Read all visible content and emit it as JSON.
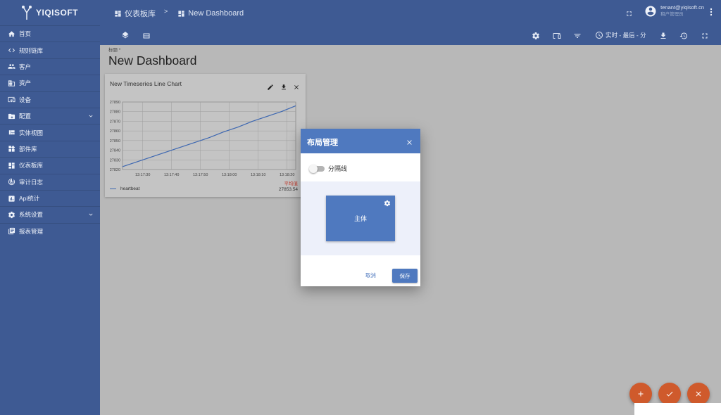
{
  "app": {
    "logo_text": "YIQISOFT"
  },
  "sidebar": {
    "items": [
      {
        "label": "首页",
        "icon": "home-icon"
      },
      {
        "label": "规则链库",
        "icon": "code-icon"
      },
      {
        "label": "客户",
        "icon": "people-icon"
      },
      {
        "label": "资产",
        "icon": "domain-icon"
      },
      {
        "label": "设备",
        "icon": "devices-icon"
      },
      {
        "label": "配置",
        "icon": "settings-box-icon",
        "expandable": true
      },
      {
        "label": "实体视图",
        "icon": "view-quilt-icon"
      },
      {
        "label": "部件库",
        "icon": "widgets-icon"
      },
      {
        "label": "仪表板库",
        "icon": "dashboard-icon"
      },
      {
        "label": "审计日志",
        "icon": "track-changes-icon"
      },
      {
        "label": "Api统计",
        "icon": "insert-chart-icon"
      },
      {
        "label": "系统设置",
        "icon": "gear-icon",
        "expandable": true
      },
      {
        "label": "报表管理",
        "icon": "report-icon"
      }
    ]
  },
  "header": {
    "breadcrumb": [
      {
        "label": "仪表板库"
      },
      {
        "separator": ">"
      },
      {
        "label": "New Dashboard"
      }
    ],
    "user": {
      "email": "tenant@yiqisoft.cn",
      "role": "租户管理员"
    }
  },
  "toolbar": {
    "timewindow_label": "实时 - 最后 - 分"
  },
  "dashboard": {
    "title_label": "标题 *",
    "title": "New Dashboard"
  },
  "widget": {
    "title": "New Timeseries Line Chart",
    "legend": {
      "series": "heartbeat",
      "avg_header": "平均值",
      "avg_value": "27853.54"
    }
  },
  "chart_data": {
    "type": "line",
    "title": "New Timeseries Line Chart",
    "xlabel": "",
    "ylabel": "",
    "ylim": [
      27820,
      27890
    ],
    "yticks": [
      27820,
      27830,
      27840,
      27850,
      27860,
      27870,
      27880,
      27890
    ],
    "xticks": [
      "13:17:30",
      "13:17:40",
      "13:17:50",
      "13:18:00",
      "13:18:10",
      "13:18:20"
    ],
    "xrange": [
      0,
      60
    ],
    "xtick_positions": [
      7,
      17,
      27,
      37,
      47,
      57
    ],
    "series": [
      {
        "name": "heartbeat",
        "color": "#3d67b1",
        "x": [
          0,
          5,
          10,
          15,
          20,
          25,
          30,
          35,
          40,
          45,
          50,
          55,
          60
        ],
        "values": [
          27823,
          27828,
          27833,
          27838,
          27843,
          27848,
          27853,
          27859,
          27864,
          27870,
          27875,
          27880,
          27886
        ]
      }
    ],
    "grid": true
  },
  "modal": {
    "title": "布局管理",
    "toggle_label": "分隔线",
    "layout_main_label": "主体",
    "cancel_label": "取消",
    "save_label": "保存"
  },
  "colors": {
    "primary": "#3e5a93",
    "accent": "#4f79bf",
    "fab": "#cf5a2c"
  }
}
